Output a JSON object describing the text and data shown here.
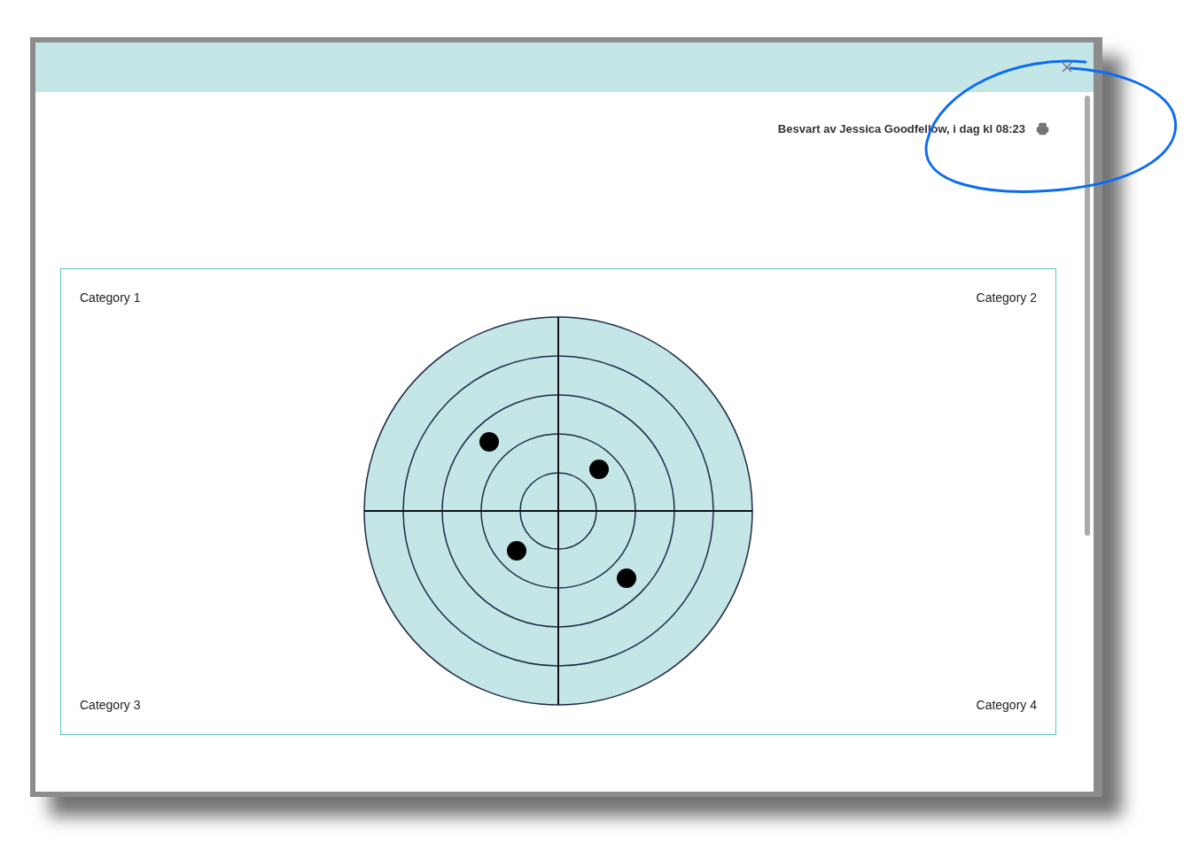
{
  "dialog": {
    "answered_by": "Besvart av Jessica Goodfellow, i dag kl 08:23"
  },
  "target": {
    "categories": [
      {
        "label": "Category 1"
      },
      {
        "label": "Category 2"
      },
      {
        "label": "Category 3"
      },
      {
        "label": "Category 4"
      }
    ]
  }
}
